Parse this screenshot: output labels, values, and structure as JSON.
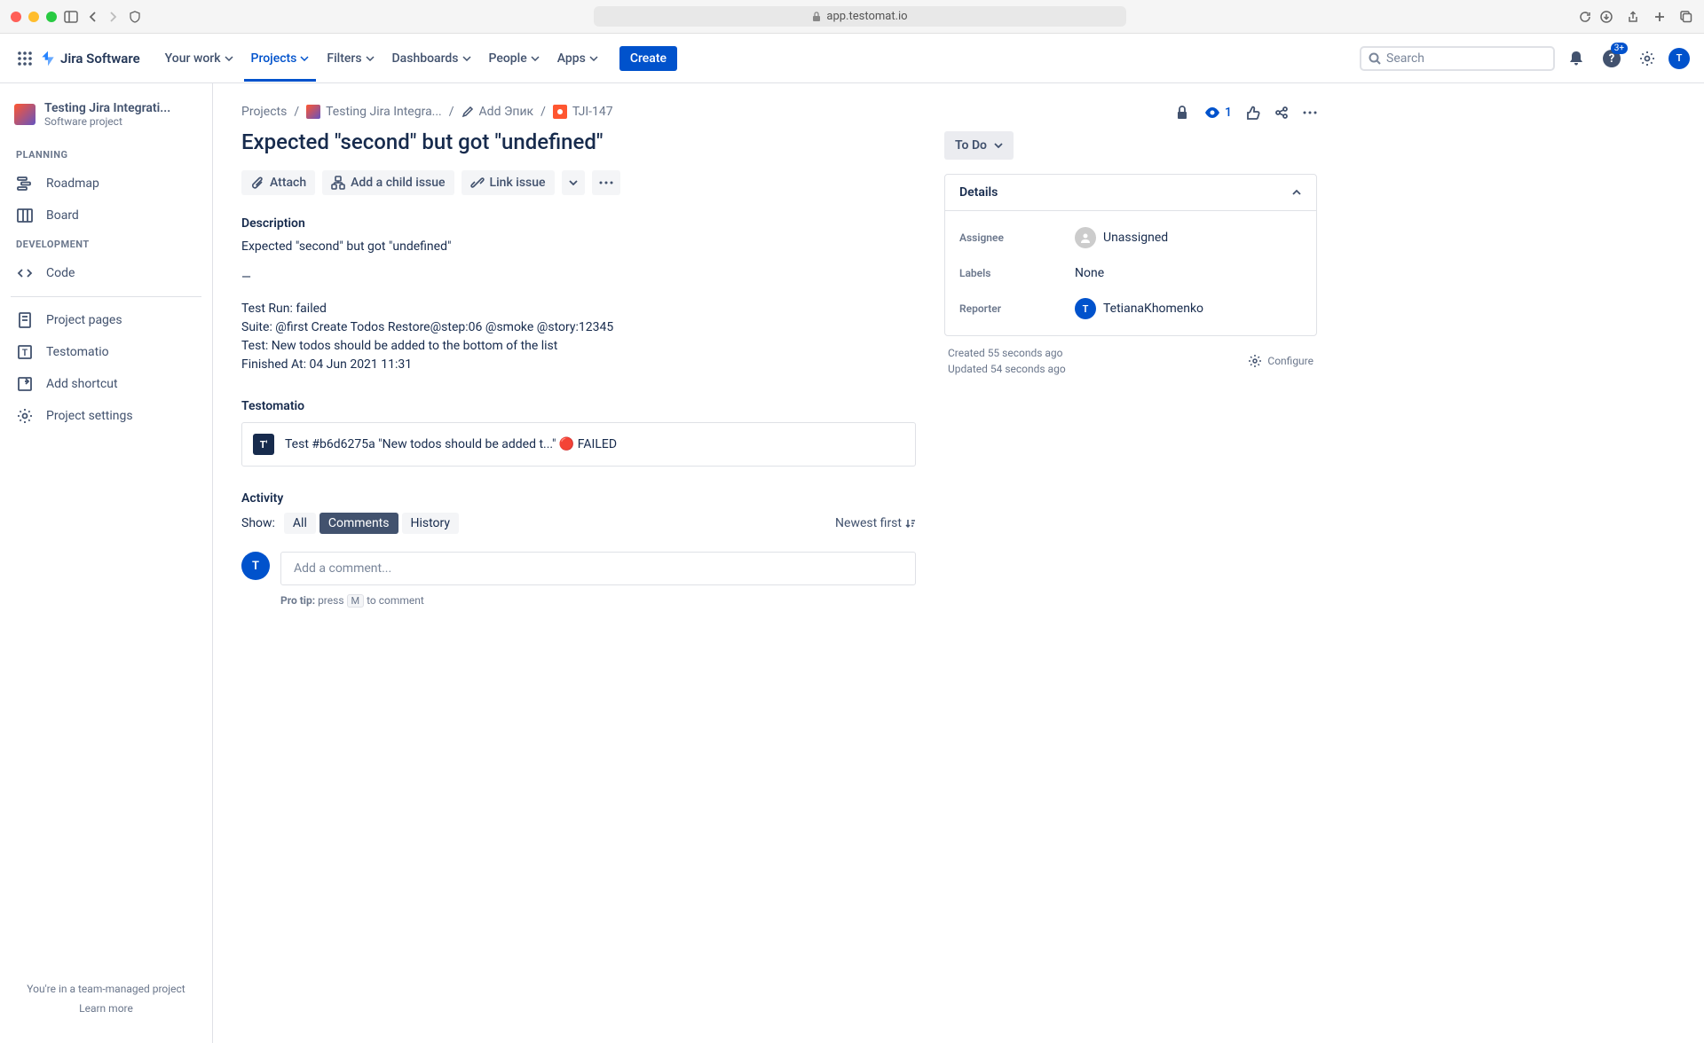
{
  "browser": {
    "url": "app.testomat.io"
  },
  "nav": {
    "logo": "Jira Software",
    "items": [
      "Your work",
      "Projects",
      "Filters",
      "Dashboards",
      "People",
      "Apps"
    ],
    "create": "Create",
    "search_placeholder": "Search",
    "notification_badge": "3+",
    "avatar_initial": "T"
  },
  "sidebar": {
    "project_name": "Testing Jira Integrati...",
    "project_type": "Software project",
    "sections": {
      "planning": "PLANNING",
      "development": "DEVELOPMENT"
    },
    "items": {
      "roadmap": "Roadmap",
      "board": "Board",
      "code": "Code",
      "project_pages": "Project pages",
      "testomatio": "Testomatio",
      "add_shortcut": "Add shortcut",
      "project_settings": "Project settings"
    },
    "footer": "You're in a team-managed project",
    "learn_more": "Learn more"
  },
  "breadcrumb": {
    "projects": "Projects",
    "project": "Testing Jira Integra...",
    "epic": "Add Эпик",
    "issue_key": "TJI-147"
  },
  "issue": {
    "title": "Expected \"second\" but got \"undefined\"",
    "actions": {
      "attach": "Attach",
      "add_child": "Add a child issue",
      "link": "Link issue"
    },
    "description_heading": "Description",
    "description_lines": [
      "Expected \"second\" but got \"undefined\"",
      "—",
      "Test Run: failed",
      "Suite: @first Create Todos Restore@step:06 @smoke @story:12345",
      "Test: New todos should be added to the bottom of the list",
      "Finished At: 04 Jun 2021 11:31"
    ],
    "testomatio_heading": "Testomatio",
    "testomatio_card": "Test #b6d6275a \"New todos should be added t...\" 🔴 FAILED",
    "activity_heading": "Activity",
    "show_label": "Show:",
    "tabs": {
      "all": "All",
      "comments": "Comments",
      "history": "History"
    },
    "sort": "Newest first",
    "comment_placeholder": "Add a comment...",
    "pro_tip_label": "Pro tip:",
    "pro_tip_press": "press",
    "pro_tip_key": "M",
    "pro_tip_rest": "to comment"
  },
  "right": {
    "watchers": "1",
    "status": "To Do",
    "details_heading": "Details",
    "fields": {
      "assignee_label": "Assignee",
      "assignee_value": "Unassigned",
      "labels_label": "Labels",
      "labels_value": "None",
      "reporter_label": "Reporter",
      "reporter_value": "TetianaKhomenko",
      "reporter_initial": "T"
    },
    "created": "Created 55 seconds ago",
    "updated": "Updated 54 seconds ago",
    "configure": "Configure"
  }
}
